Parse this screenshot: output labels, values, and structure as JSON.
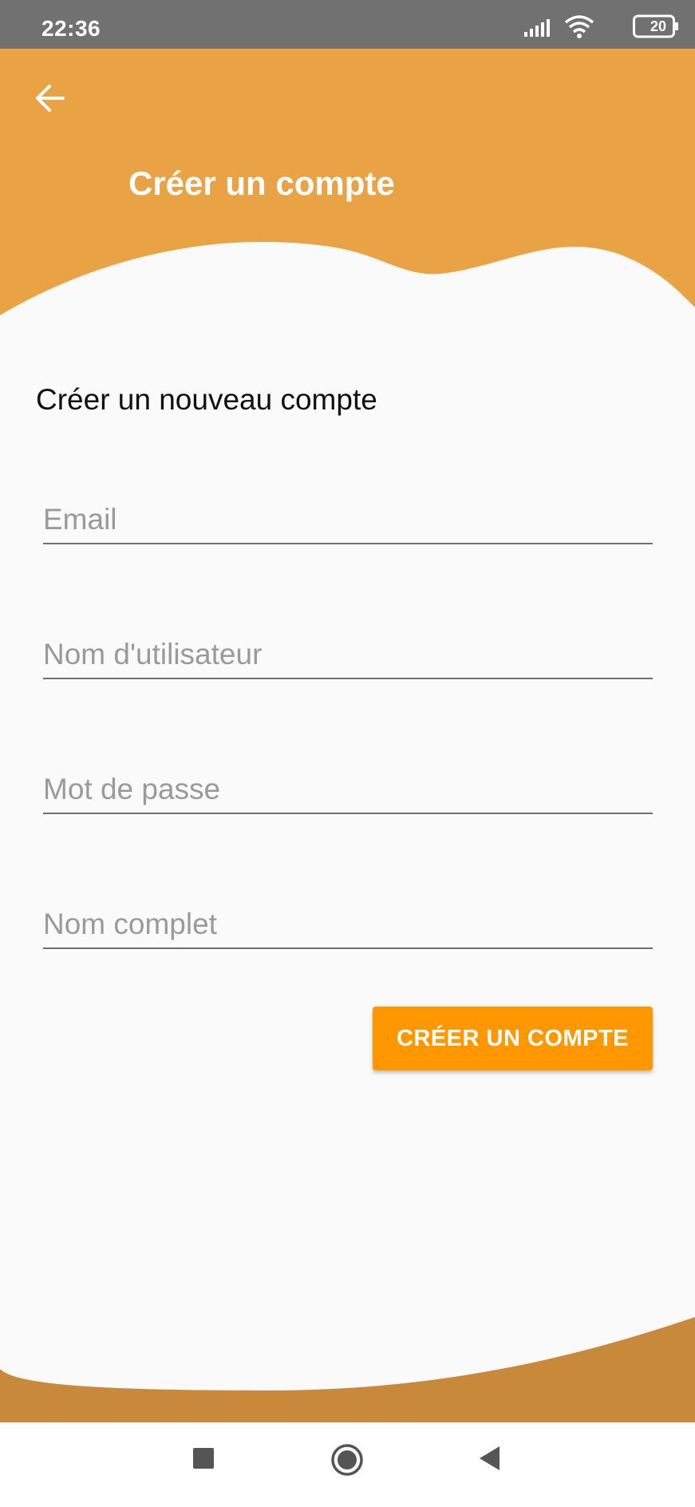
{
  "status_bar": {
    "time": "22:36",
    "battery": "20",
    "icons": [
      "signal-icon",
      "wifi-icon",
      "battery-icon"
    ]
  },
  "header": {
    "title": "Créer un compte",
    "back_icon": "arrow-left-icon",
    "background_color": "#e9a244"
  },
  "form": {
    "heading": "Créer un nouveau compte",
    "fields": [
      {
        "name": "email",
        "placeholder": "Email",
        "value": ""
      },
      {
        "name": "username",
        "placeholder": "Nom d'utilisateur",
        "value": ""
      },
      {
        "name": "password",
        "placeholder": "Mot de passe",
        "value": ""
      },
      {
        "name": "full_name",
        "placeholder": "Nom complet",
        "value": ""
      }
    ],
    "submit_label": "CRÉER UN COMPTE",
    "submit_color": "#ff9800"
  },
  "footer": {
    "wave_color": "#c8893a"
  },
  "nav_bar": {
    "icons": [
      "recents-square-icon",
      "home-circle-icon",
      "back-triangle-icon"
    ]
  }
}
